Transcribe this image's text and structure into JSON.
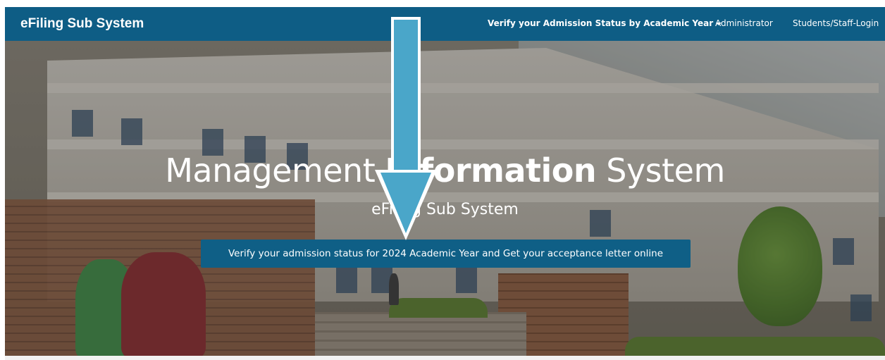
{
  "navbar": {
    "brand": "eFiling Sub System",
    "items": [
      {
        "label": "Verify your Admission Status by Academic Year"
      },
      {
        "label": "Administrator"
      },
      {
        "label": "Students/Staff-Login"
      }
    ]
  },
  "hero": {
    "title_part1": "Management ",
    "title_part2": "Information",
    "title_part3": " System",
    "subtitle": "eFiling Sub System",
    "cta_label": "Verify your admission status for 2024 Academic Year and Get your acceptance letter online"
  },
  "colors": {
    "navbar_bg": "#0e5d85",
    "cta_bg": "#0f5f86",
    "annotation_arrow": "#4aa6c9"
  },
  "icons": {
    "dropdown": "caret-down-icon",
    "annotation": "arrow-down-icon"
  }
}
